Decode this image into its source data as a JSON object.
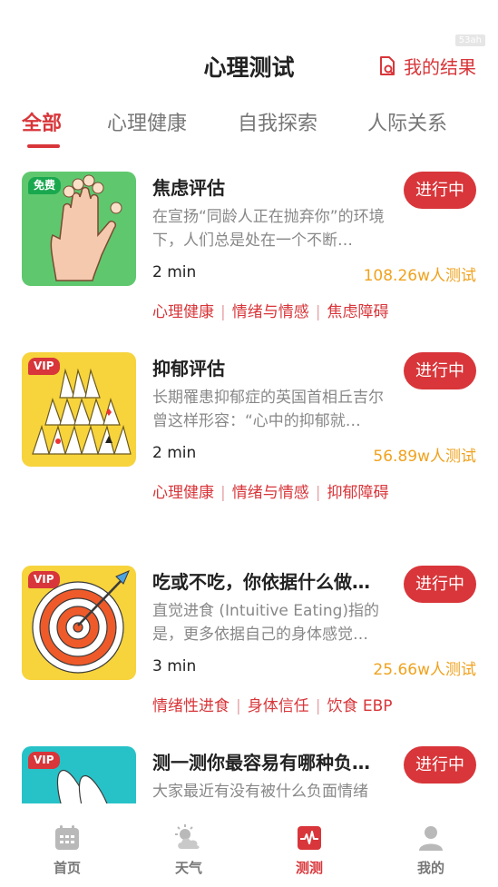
{
  "status": {
    "badge": "53ah"
  },
  "header": {
    "title": "心理测试",
    "my_results": "我的结果"
  },
  "tabs": [
    {
      "label": "全部",
      "active": true
    },
    {
      "label": "心理健康",
      "active": false
    },
    {
      "label": "自我探索",
      "active": false
    },
    {
      "label": "人际关系",
      "active": false
    }
  ],
  "cards": [
    {
      "title": "焦虑评估",
      "desc": "在宣扬“同龄人正在抛弃你”的环境下，人们总是处在一个不断…",
      "duration": "2 min",
      "count": "108.26w人测试",
      "button": "进行中",
      "badge": "免费",
      "tags": [
        "心理健康",
        "情绪与情感",
        "焦虑障碍"
      ]
    },
    {
      "title": "抑郁评估",
      "desc": "长期罹患抑郁症的英国首相丘吉尔曾这样形容：“心中的抑郁就…",
      "duration": "2 min",
      "count": "56.89w人测试",
      "button": "进行中",
      "badge": "VIP",
      "tags": [
        "心理健康",
        "情绪与情感",
        "抑郁障碍"
      ]
    },
    {
      "title": "吃或不吃，你依据什么做…",
      "desc": "直觉进食 (Intuitive Eating)指的是，更多依据自己的身体感觉…",
      "duration": "3 min",
      "count": "25.66w人测试",
      "button": "进行中",
      "badge": "VIP",
      "tags": [
        "情绪性进食",
        "身体信任",
        "饮食 EBP"
      ]
    },
    {
      "title": "测一测你最容易有哪种负…",
      "desc": "大家最近有没有被什么负面情绪",
      "button": "进行中",
      "badge": "VIP"
    }
  ],
  "nav": [
    {
      "label": "首页",
      "icon": "calendar-icon",
      "active": false
    },
    {
      "label": "天气",
      "icon": "weather-icon",
      "active": false
    },
    {
      "label": "测测",
      "icon": "heartbeat-icon",
      "active": true
    },
    {
      "label": "我的",
      "icon": "user-icon",
      "active": false
    }
  ],
  "colors": {
    "accent": "#d8363a",
    "count": "#f0a21e",
    "free_badge": "#1aa84f",
    "vip_badge": "#d8363a"
  }
}
